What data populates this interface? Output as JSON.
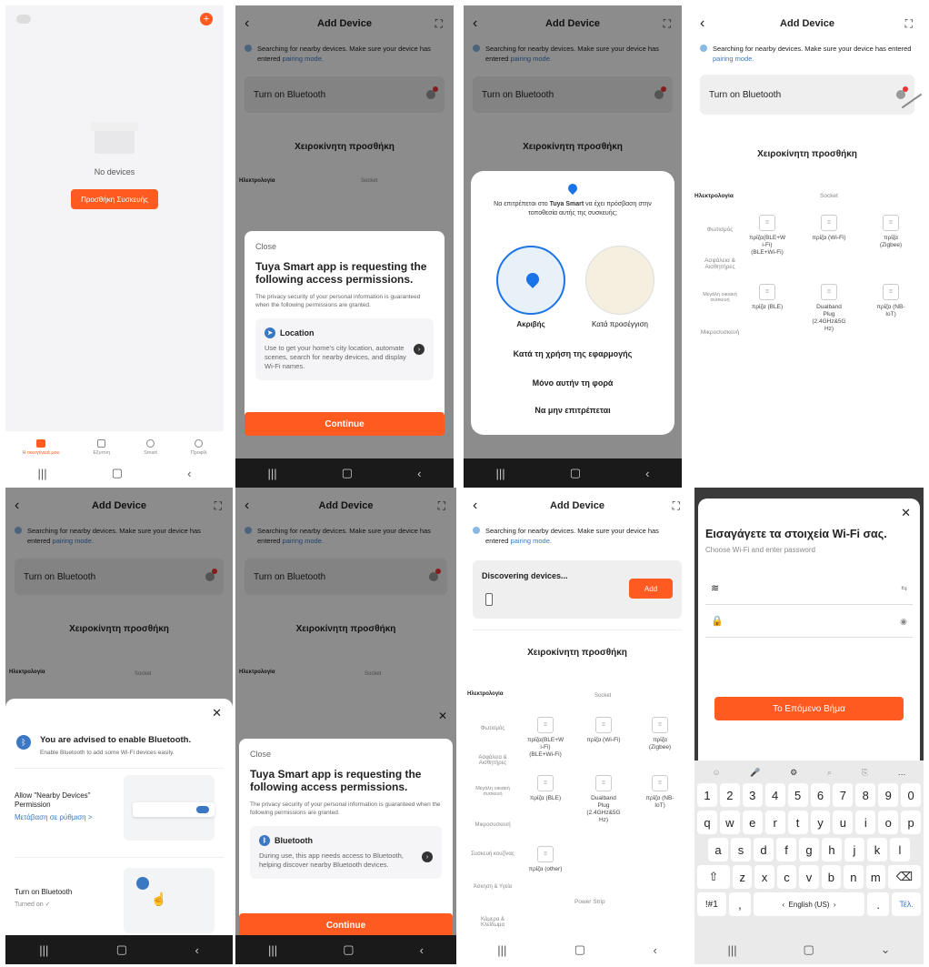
{
  "p1": {
    "empty_text": "No devices",
    "add_button": "Προσθήκη Συσκευής",
    "tabs": [
      "Η οικογένειά μου",
      "Εξυπνη",
      "Smart",
      "Προφίλ"
    ]
  },
  "common": {
    "title": "Add Device",
    "search_note": "Searching for nearby devices. Make sure your device has entered",
    "pairing": "pairing mode.",
    "bt": "Turn on Bluetooth",
    "manual": "Χειροκίνητη προσθήκη",
    "cat_elec": "Ηλεκτρολογία",
    "socket": "Socket",
    "lighting": "Φωτισμός",
    "plug_ble_wifi": "πρίζα(BLE+W",
    "plug_short": "πρίζα",
    "close": "Close",
    "continue": "Continue"
  },
  "p2": {
    "perm_title": "Tuya Smart app is requesting the following access permissions.",
    "perm_sub": "The privacy security of your personal information is guaranteed when the following permissions are granted.",
    "loc_title": "Location",
    "loc_desc": "Use to get your home's city location, automate scenes, search for nearby devices, and display Wi-Fi names."
  },
  "p3": {
    "prompt_pre": "Να επιτρέπεται στο",
    "prompt_app": "Tuya Smart",
    "prompt_post": "να έχει πρόσβαση στην τοποθεσία αυτής της συσκευής;",
    "precise": "Ακριβής",
    "approx": "Κατά προσέγγιση",
    "opt1": "Κατά τη χρήση της εφαρμογής",
    "opt2": "Μόνο αυτήν τη φορά",
    "opt3": "Να μην επιτρέπεται"
  },
  "p4": {
    "cats": [
      "Φωτισμός",
      "Ασφάλεια & Αισθητήρες",
      "Μεγάλη οικιακή συσκευή",
      "Μικροσυσκευή"
    ],
    "devs": [
      {
        "label": "πρίζα(BLE+W i-Fi) (BLE+Wi-Fi)"
      },
      {
        "label": "πρίζα (Wi-Fi)"
      },
      {
        "label": "πρίζα (Zigbee)"
      },
      {
        "label": "πρίζα (BLE)"
      },
      {
        "label": "Dualband Plug (2.4GHz&5G Hz)"
      },
      {
        "label": "πρίζα (NB-IoT)"
      }
    ]
  },
  "p5": {
    "advise": "You are advised to enable Bluetooth.",
    "advise_sub": "Enable Bluetooth to add some Wi-Fi devices easily.",
    "nearby": "Allow \"Nearby Devices\" Permission",
    "goto": "Μετάβαση σε ρύθμιση >",
    "bt_on": "Turn on Bluetooth",
    "turned_on": "Turned on ✓"
  },
  "p6": {
    "bt_title": "Bluetooth",
    "bt_desc": "During use, this app needs access to Bluetooth, helping discover nearby Bluetooth devices."
  },
  "p7": {
    "discovering": "Discovering devices...",
    "add": "Add",
    "cats": [
      "Φωτισμός",
      "Ασφάλεια & Αισθητήρες",
      "Μεγάλη οικιακή συσκευή",
      "Μικροσυσκευή",
      "Συσκευή κουζίνας",
      "Άσκηση & Υγεία",
      "Κάμερα & Κλείδωμα"
    ],
    "other": "πρίζα (other)",
    "power_strip": "Power Strip"
  },
  "p8": {
    "title": "Εισαγάγετε τα στοιχεία Wi-Fi σας.",
    "subtitle": "Choose Wi-Fi and enter password",
    "next": "Το Επόμενο Βήμα",
    "row_nums": [
      "1",
      "2",
      "3",
      "4",
      "5",
      "6",
      "7",
      "8",
      "9",
      "0"
    ],
    "row_q": [
      "q",
      "w",
      "e",
      "r",
      "t",
      "y",
      "u",
      "i",
      "o",
      "p"
    ],
    "row_a": [
      "a",
      "s",
      "d",
      "f",
      "g",
      "h",
      "j",
      "k",
      "l"
    ],
    "row_z": [
      "z",
      "x",
      "c",
      "v",
      "b",
      "n",
      "m"
    ],
    "sym": "!#1",
    "comma": ",",
    "lang": "English (US)",
    "dot": ".",
    "enter": "Τέλ."
  }
}
